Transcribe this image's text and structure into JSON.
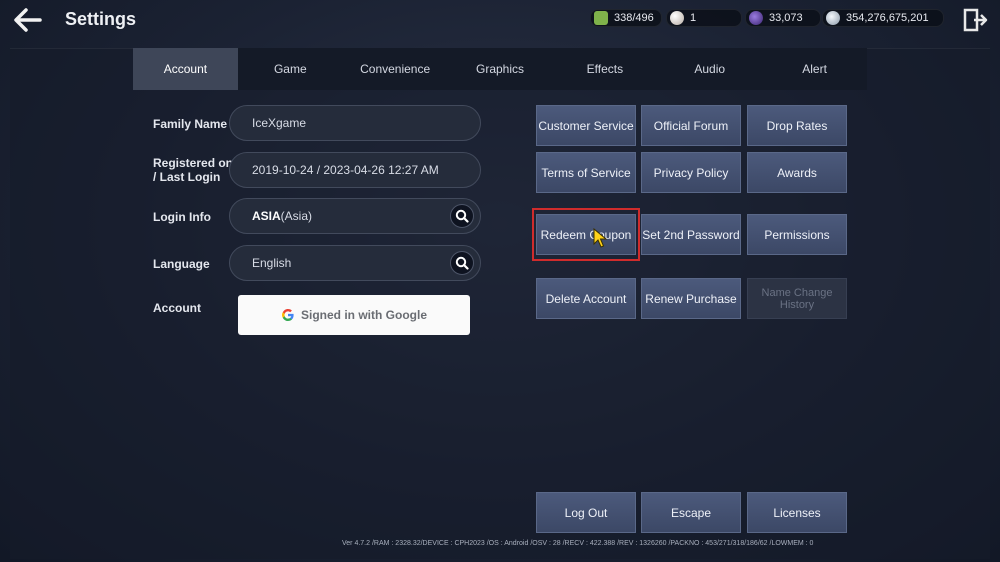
{
  "header": {
    "title": "Settings",
    "currencies": [
      {
        "value": "338/496",
        "icon": "stamina-icon",
        "color": "#7fb24a"
      },
      {
        "value": "1",
        "icon": "pearl-icon",
        "color": "#d9d2cc"
      },
      {
        "value": "33,073",
        "icon": "black-stone-icon",
        "color": "#6a4bb0"
      },
      {
        "value": "354,276,675,201",
        "icon": "silver-coin-icon",
        "color": "#c8d4e0"
      }
    ]
  },
  "tabs": [
    "Account",
    "Game",
    "Convenience",
    "Graphics",
    "Effects",
    "Audio",
    "Alert"
  ],
  "account": {
    "family_name_label": "Family Name",
    "family_name_value": "IceXgame",
    "registered_label_1": "Registered on",
    "registered_label_2": "/ Last Login",
    "registered_value": "2019-10-24 / 2023-04-26  12:27  AM",
    "login_info_label": "Login Info",
    "login_info_value_bold": "ASIA",
    "login_info_value_rest": "(Asia)",
    "language_label": "Language",
    "language_value": "English",
    "account_label": "Account",
    "google_button": "Signed in with Google"
  },
  "buttons": {
    "customer_service": "Customer Service",
    "official_forum": "Official Forum",
    "drop_rates": "Drop Rates",
    "terms_of_service": "Terms of Service",
    "privacy_policy": "Privacy Policy",
    "awards": "Awards",
    "redeem_coupon": "Redeem Coupon",
    "set_2nd_password": "Set 2nd Password",
    "permissions": "Permissions",
    "delete_account": "Delete Account",
    "renew_purchase": "Renew Purchase",
    "name_change_history_1": "Name Change",
    "name_change_history_2": "History",
    "log_out": "Log Out",
    "escape": "Escape",
    "licenses": "Licenses"
  },
  "footer": "Ver 4.7.2 /RAM : 2328.32/DEVICE : CPH2023 /OS : Android /OSV : 28 /RECV : 422.388 /REV : 1326260 /PACKNO : 453/271/318/186/62 /LOWMEM : 0"
}
